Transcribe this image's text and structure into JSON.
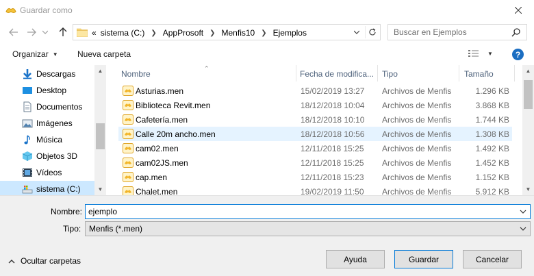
{
  "window": {
    "title": "Guardar como"
  },
  "address": {
    "crumbs": [
      "sistema (C:)",
      "AppProsoft",
      "Menfis10",
      "Ejemplos"
    ],
    "overflow": "«"
  },
  "search": {
    "placeholder": "Buscar en Ejemplos"
  },
  "toolbar": {
    "organize": "Organizar",
    "new_folder": "Nueva carpeta",
    "help": "?"
  },
  "nav": {
    "items": [
      {
        "label": "Descargas",
        "icon": "download-icon"
      },
      {
        "label": "Desktop",
        "icon": "desktop-icon"
      },
      {
        "label": "Documentos",
        "icon": "document-icon"
      },
      {
        "label": "Imágenes",
        "icon": "pictures-icon"
      },
      {
        "label": "Música",
        "icon": "music-icon"
      },
      {
        "label": "Objetos 3D",
        "icon": "3d-objects-icon"
      },
      {
        "label": "Vídeos",
        "icon": "videos-icon"
      },
      {
        "label": "sistema (C:)",
        "icon": "drive-icon",
        "selected": true
      }
    ]
  },
  "files": {
    "columns": {
      "name": "Nombre",
      "date": "Fecha de modifica...",
      "type": "Tipo",
      "size": "Tamaño"
    },
    "rows": [
      {
        "name": "Asturias.men",
        "date": "15/02/2019 13:27",
        "type": "Archivos de Menfis",
        "size": "1.296 KB"
      },
      {
        "name": "Biblioteca Revit.men",
        "date": "18/12/2018 10:04",
        "type": "Archivos de Menfis",
        "size": "3.868 KB"
      },
      {
        "name": "Cafetería.men",
        "date": "18/12/2018 10:10",
        "type": "Archivos de Menfis",
        "size": "1.744 KB"
      },
      {
        "name": "Calle 20m ancho.men",
        "date": "18/12/2018 10:56",
        "type": "Archivos de Menfis",
        "size": "1.308 KB",
        "hover": true
      },
      {
        "name": "cam02.men",
        "date": "12/11/2018 15:25",
        "type": "Archivos de Menfis",
        "size": "1.492 KB"
      },
      {
        "name": "cam02JS.men",
        "date": "12/11/2018 15:25",
        "type": "Archivos de Menfis",
        "size": "1.452 KB"
      },
      {
        "name": "cap.men",
        "date": "12/11/2018 15:23",
        "type": "Archivos de Menfis",
        "size": "1.152 KB"
      },
      {
        "name": "Chalet.men",
        "date": "19/02/2019 11:50",
        "type": "Archivos de Menfis",
        "size": "5.912 KB"
      }
    ]
  },
  "form": {
    "name_label": "Nombre:",
    "name_value": "ejemplo",
    "type_label": "Tipo:",
    "type_value": "Menfis (*.men)"
  },
  "footer": {
    "hide_folders": "Ocultar carpetas",
    "help_button": "Ayuda",
    "save_button": "Guardar",
    "cancel_button": "Cancelar"
  },
  "colors": {
    "accent": "#0078d7",
    "selection": "#cce8ff",
    "hover": "#e5f3ff",
    "header_text": "#4c607a"
  }
}
